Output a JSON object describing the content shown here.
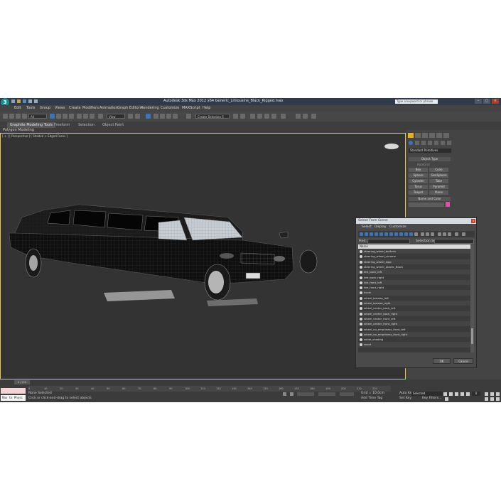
{
  "app": {
    "title": "Autodesk 3ds Max 2012 x64     Generic_Limousine_Black_Rigged.max",
    "logo_label": "3",
    "search_placeholder": "Type a keyword or phrase"
  },
  "menu": [
    "Edit",
    "Tools",
    "Group",
    "Views",
    "Create",
    "Modifiers",
    "Animation",
    "Graph Editors",
    "Rendering",
    "Customize",
    "MAXScript",
    "Help"
  ],
  "toolbar": {
    "selection_filter": "All",
    "reference_coord": "View",
    "named_selection": "Create Selection S"
  },
  "ribbon": {
    "tabs": [
      "Graphite Modeling Tools",
      "Freeform",
      "Selection",
      "Object Paint"
    ],
    "subtitle": "Polygon Modeling"
  },
  "viewport": {
    "label": "[ + ] [ Perspective ] [ Shaded + Edged Faces ]"
  },
  "command_panel": {
    "category": "Standard Primitives",
    "object_type_title": "Object Type",
    "autogrid_label": "AutoGrid",
    "objects": [
      "Box",
      "Cone",
      "Sphere",
      "GeoSphere",
      "Cylinder",
      "Tube",
      "Torus",
      "Pyramid",
      "Teapot",
      "Plane"
    ],
    "name_color_title": "Name and Color"
  },
  "dialog": {
    "title": "Select From Scene",
    "tabs": [
      "Select",
      "Display",
      "Customize"
    ],
    "find_label": "Find:",
    "selection_set_label": "Selection Set:",
    "column_header": "Name",
    "items": [
      "steering_wheel_buttons",
      "steering_wheel_chrome",
      "steering_wheel_logo",
      "steering_wheel_plastic_Black",
      "tire_back_left",
      "tire_back_right",
      "tire_front_left",
      "tire_front_right",
      "trunk",
      "wheel_browse_left",
      "wheel_browse_right",
      "wheel_center_back_left",
      "wheel_center_back_right",
      "wheel_center_front_left",
      "wheel_center_front_right",
      "wheel_no_emptiness_front_left",
      "wheel_no_emptiness_front_right",
      "white_shading",
      "wood"
    ],
    "ok_label": "OK",
    "cancel_label": "Cancel"
  },
  "timeline": {
    "frame_indicator": "0 / 225",
    "ticks": [
      "0",
      "10",
      "20",
      "30",
      "40",
      "50",
      "60",
      "70",
      "80",
      "90",
      "100",
      "110",
      "120",
      "130",
      "140",
      "150",
      "160",
      "170",
      "180",
      "190",
      "200",
      "210",
      "220"
    ]
  },
  "status": {
    "maxscript_label": "Max to Physc",
    "selection_status": "None Selected",
    "prompt": "Click or click-and-drag to select objects",
    "grid": "Grid = 10,0cm",
    "add_time_tag": "Add Time Tag",
    "auto_key": "Auto Key",
    "auto_key_value": "Selected",
    "set_key": "Set Key",
    "key_filters": "Key Filters...",
    "frame_value": "0"
  }
}
